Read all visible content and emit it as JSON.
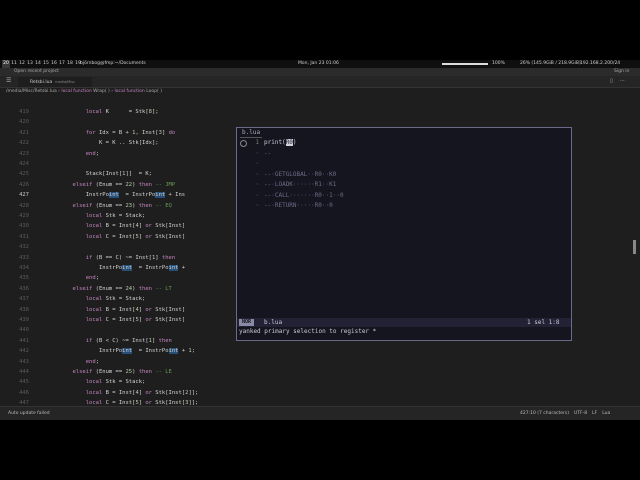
{
  "topbar": {
    "workspaces": [
      "20",
      "11",
      "12",
      "13",
      "14",
      "15",
      "16",
      "17",
      "18",
      "19"
    ],
    "active_workspace": "20",
    "window_title": "björnbog@fmp:~/Documents",
    "clock": "Mon, Jan 23  01:06",
    "volume_pct": 100,
    "volume": "100%",
    "cpu_ram": "26% (145.9GiB / 218.9GiB)",
    "ip": "192.168.2.200/24"
  },
  "window": {
    "open_recent": "Open recent project",
    "sign_in": "Sign in"
  },
  "tab": {
    "label": "Retsbi.lua",
    "sub": "media/Misc"
  },
  "breadcrumb": {
    "path": "/media/Misc/Retsbi.lua",
    "k1": "local function",
    "f1": "Wrap( )",
    "k2": "local function",
    "f2": "Loop( )"
  },
  "code": {
    "current_line": "427",
    "lines": [
      {
        "n": "419",
        "t": "            local K      = Stk[8];"
      },
      {
        "n": "420",
        "t": ""
      },
      {
        "n": "421",
        "t": "            for Idx = B + 1, Inst[3] do"
      },
      {
        "n": "422",
        "t": "                K = K .. Stk[Idx];"
      },
      {
        "n": "423",
        "t": "            end;"
      },
      {
        "n": "424",
        "t": ""
      },
      {
        "n": "425",
        "t": "            Stack[Inst[1]]  = K;"
      },
      {
        "n": "426",
        "t": "        elseif (Enum == 22) then -- JMP"
      },
      {
        "n": "427",
        "t": "            InstrPoint  = InstrPoint + Ins"
      },
      {
        "n": "428",
        "t": "        elseif (Enum == 23) then -- EQ"
      },
      {
        "n": "429",
        "t": "            local Stk = Stack;"
      },
      {
        "n": "430",
        "t": "            local B = Inst[4] or Stk[Inst["
      },
      {
        "n": "431",
        "t": "            local C = Inst[5] or Stk[Inst["
      },
      {
        "n": "432",
        "t": ""
      },
      {
        "n": "433",
        "t": "            if (B == C) ~= Inst[1] then"
      },
      {
        "n": "434",
        "t": "                InstrPoint  = InstrPoint +"
      },
      {
        "n": "435",
        "t": "            end;"
      },
      {
        "n": "436",
        "t": "        elseif (Enum == 24) then -- LT"
      },
      {
        "n": "437",
        "t": "            local Stk = Stack;"
      },
      {
        "n": "438",
        "t": "            local B = Inst[4] or Stk[Inst["
      },
      {
        "n": "439",
        "t": "            local C = Inst[5] or Stk[Inst["
      },
      {
        "n": "440",
        "t": ""
      },
      {
        "n": "441",
        "t": "            if (B < C) ~= Inst[1] then"
      },
      {
        "n": "442",
        "t": "                InstrPoint  = InstrPoint + 1;"
      },
      {
        "n": "443",
        "t": "            end;"
      },
      {
        "n": "444",
        "t": "        elseif (Enum == 25) then -- LE"
      },
      {
        "n": "445",
        "t": "            local Stk = Stack;"
      },
      {
        "n": "446",
        "t": "            local B = Inst[4] or Stk[Inst[2]];"
      },
      {
        "n": "447",
        "t": "            local C = Inst[5] or Stk[Inst[3]];"
      }
    ]
  },
  "popup": {
    "title": "b.lua",
    "lines": [
      {
        "n": "1",
        "t": "print(R0)"
      },
      {
        "n": "",
        "t": "--"
      },
      {
        "n": "",
        "t": ""
      },
      {
        "n": "",
        "t": "-- GETGLOBAL  R0  K0"
      },
      {
        "n": "",
        "t": "-- LOADK      R1  K1"
      },
      {
        "n": "",
        "t": "-- CALL       R0  1  0"
      },
      {
        "n": "",
        "t": "-- RETURN     R0  0"
      }
    ],
    "mode": "NOR",
    "file": "b.lua",
    "sel": "1 sel   1:8",
    "message": "yanked primary selection to register *"
  },
  "status": {
    "left": [
      "Auto update failed"
    ],
    "right": [
      "427:10 (7 characters)",
      "UTF-8",
      "LF",
      "Lua"
    ]
  }
}
